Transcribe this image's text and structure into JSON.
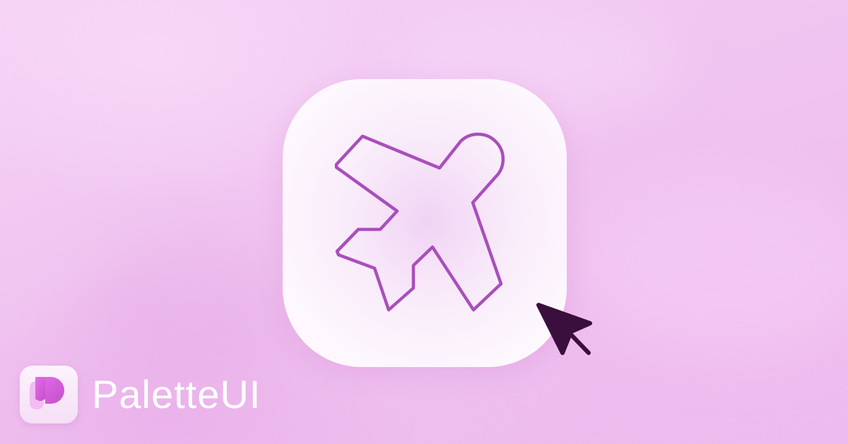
{
  "brand": {
    "name": "PaletteUI",
    "logo_icon": "palette-p-logo-icon"
  },
  "hero": {
    "icon": "airplane-icon",
    "pointer": "cursor-arrow-icon"
  },
  "colors": {
    "icon_stroke": "#a94fbb",
    "cursor": "#3a0f3e",
    "brand_text": "#ffffff",
    "logo_accent": "#d05bd6"
  }
}
